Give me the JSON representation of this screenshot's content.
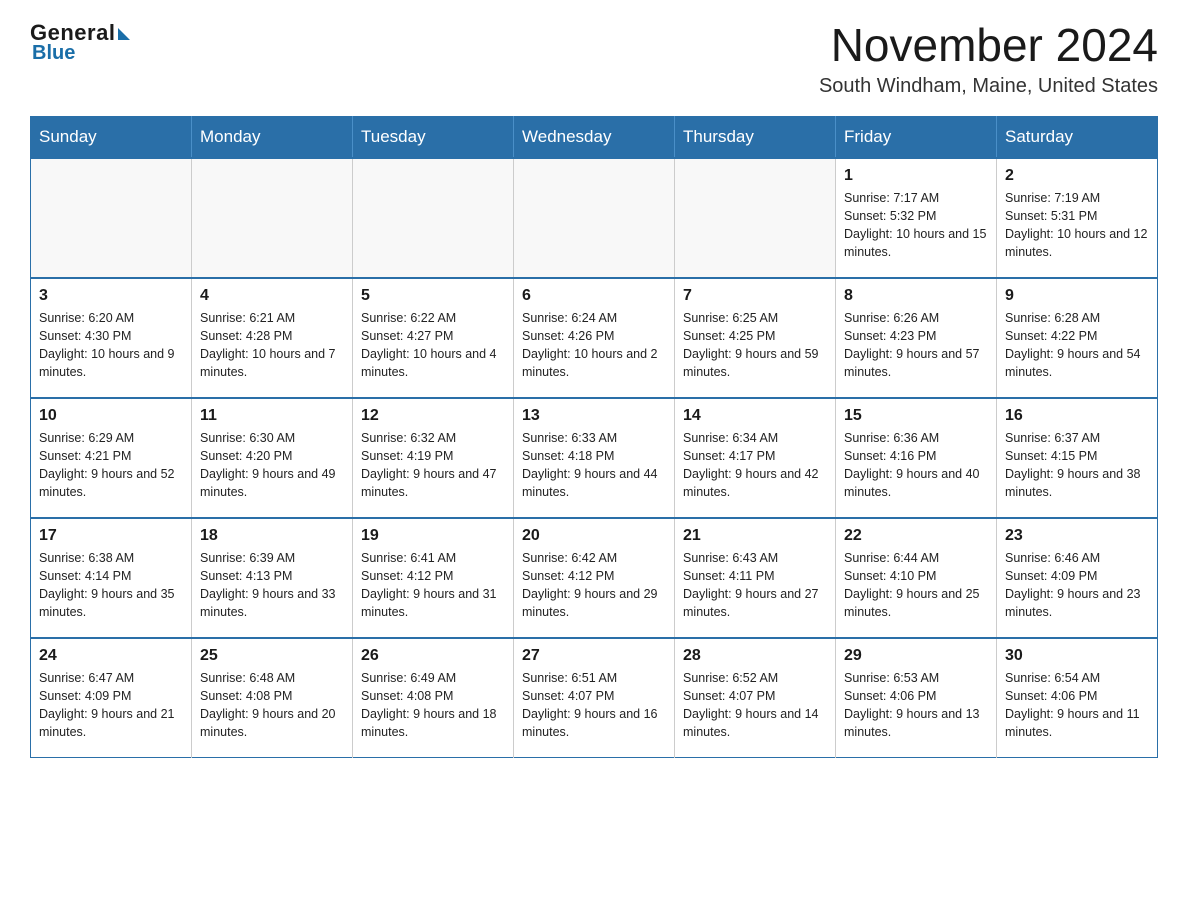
{
  "header": {
    "logo": {
      "general": "General",
      "blue": "Blue"
    },
    "title": "November 2024",
    "location": "South Windham, Maine, United States"
  },
  "calendar": {
    "days_of_week": [
      "Sunday",
      "Monday",
      "Tuesday",
      "Wednesday",
      "Thursday",
      "Friday",
      "Saturday"
    ],
    "weeks": [
      [
        {
          "day": "",
          "info": "",
          "empty": true
        },
        {
          "day": "",
          "info": "",
          "empty": true
        },
        {
          "day": "",
          "info": "",
          "empty": true
        },
        {
          "day": "",
          "info": "",
          "empty": true
        },
        {
          "day": "",
          "info": "",
          "empty": true
        },
        {
          "day": "1",
          "info": "Sunrise: 7:17 AM\nSunset: 5:32 PM\nDaylight: 10 hours and 15 minutes.",
          "empty": false
        },
        {
          "day": "2",
          "info": "Sunrise: 7:19 AM\nSunset: 5:31 PM\nDaylight: 10 hours and 12 minutes.",
          "empty": false
        }
      ],
      [
        {
          "day": "3",
          "info": "Sunrise: 6:20 AM\nSunset: 4:30 PM\nDaylight: 10 hours and 9 minutes.",
          "empty": false
        },
        {
          "day": "4",
          "info": "Sunrise: 6:21 AM\nSunset: 4:28 PM\nDaylight: 10 hours and 7 minutes.",
          "empty": false
        },
        {
          "day": "5",
          "info": "Sunrise: 6:22 AM\nSunset: 4:27 PM\nDaylight: 10 hours and 4 minutes.",
          "empty": false
        },
        {
          "day": "6",
          "info": "Sunrise: 6:24 AM\nSunset: 4:26 PM\nDaylight: 10 hours and 2 minutes.",
          "empty": false
        },
        {
          "day": "7",
          "info": "Sunrise: 6:25 AM\nSunset: 4:25 PM\nDaylight: 9 hours and 59 minutes.",
          "empty": false
        },
        {
          "day": "8",
          "info": "Sunrise: 6:26 AM\nSunset: 4:23 PM\nDaylight: 9 hours and 57 minutes.",
          "empty": false
        },
        {
          "day": "9",
          "info": "Sunrise: 6:28 AM\nSunset: 4:22 PM\nDaylight: 9 hours and 54 minutes.",
          "empty": false
        }
      ],
      [
        {
          "day": "10",
          "info": "Sunrise: 6:29 AM\nSunset: 4:21 PM\nDaylight: 9 hours and 52 minutes.",
          "empty": false
        },
        {
          "day": "11",
          "info": "Sunrise: 6:30 AM\nSunset: 4:20 PM\nDaylight: 9 hours and 49 minutes.",
          "empty": false
        },
        {
          "day": "12",
          "info": "Sunrise: 6:32 AM\nSunset: 4:19 PM\nDaylight: 9 hours and 47 minutes.",
          "empty": false
        },
        {
          "day": "13",
          "info": "Sunrise: 6:33 AM\nSunset: 4:18 PM\nDaylight: 9 hours and 44 minutes.",
          "empty": false
        },
        {
          "day": "14",
          "info": "Sunrise: 6:34 AM\nSunset: 4:17 PM\nDaylight: 9 hours and 42 minutes.",
          "empty": false
        },
        {
          "day": "15",
          "info": "Sunrise: 6:36 AM\nSunset: 4:16 PM\nDaylight: 9 hours and 40 minutes.",
          "empty": false
        },
        {
          "day": "16",
          "info": "Sunrise: 6:37 AM\nSunset: 4:15 PM\nDaylight: 9 hours and 38 minutes.",
          "empty": false
        }
      ],
      [
        {
          "day": "17",
          "info": "Sunrise: 6:38 AM\nSunset: 4:14 PM\nDaylight: 9 hours and 35 minutes.",
          "empty": false
        },
        {
          "day": "18",
          "info": "Sunrise: 6:39 AM\nSunset: 4:13 PM\nDaylight: 9 hours and 33 minutes.",
          "empty": false
        },
        {
          "day": "19",
          "info": "Sunrise: 6:41 AM\nSunset: 4:12 PM\nDaylight: 9 hours and 31 minutes.",
          "empty": false
        },
        {
          "day": "20",
          "info": "Sunrise: 6:42 AM\nSunset: 4:12 PM\nDaylight: 9 hours and 29 minutes.",
          "empty": false
        },
        {
          "day": "21",
          "info": "Sunrise: 6:43 AM\nSunset: 4:11 PM\nDaylight: 9 hours and 27 minutes.",
          "empty": false
        },
        {
          "day": "22",
          "info": "Sunrise: 6:44 AM\nSunset: 4:10 PM\nDaylight: 9 hours and 25 minutes.",
          "empty": false
        },
        {
          "day": "23",
          "info": "Sunrise: 6:46 AM\nSunset: 4:09 PM\nDaylight: 9 hours and 23 minutes.",
          "empty": false
        }
      ],
      [
        {
          "day": "24",
          "info": "Sunrise: 6:47 AM\nSunset: 4:09 PM\nDaylight: 9 hours and 21 minutes.",
          "empty": false
        },
        {
          "day": "25",
          "info": "Sunrise: 6:48 AM\nSunset: 4:08 PM\nDaylight: 9 hours and 20 minutes.",
          "empty": false
        },
        {
          "day": "26",
          "info": "Sunrise: 6:49 AM\nSunset: 4:08 PM\nDaylight: 9 hours and 18 minutes.",
          "empty": false
        },
        {
          "day": "27",
          "info": "Sunrise: 6:51 AM\nSunset: 4:07 PM\nDaylight: 9 hours and 16 minutes.",
          "empty": false
        },
        {
          "day": "28",
          "info": "Sunrise: 6:52 AM\nSunset: 4:07 PM\nDaylight: 9 hours and 14 minutes.",
          "empty": false
        },
        {
          "day": "29",
          "info": "Sunrise: 6:53 AM\nSunset: 4:06 PM\nDaylight: 9 hours and 13 minutes.",
          "empty": false
        },
        {
          "day": "30",
          "info": "Sunrise: 6:54 AM\nSunset: 4:06 PM\nDaylight: 9 hours and 11 minutes.",
          "empty": false
        }
      ]
    ]
  }
}
